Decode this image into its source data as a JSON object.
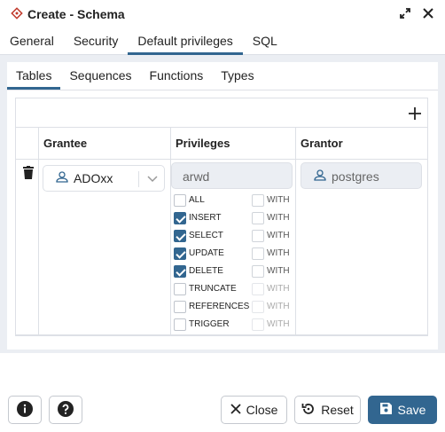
{
  "window": {
    "title": "Create - Schema"
  },
  "main_tabs": [
    "General",
    "Security",
    "Default privileges",
    "SQL"
  ],
  "sub_tabs": [
    "Tables",
    "Sequences",
    "Functions",
    "Types"
  ],
  "grid": {
    "columns": [
      "Grantee",
      "Privileges",
      "Grantor"
    ],
    "row": {
      "grantee": "ADOxx",
      "privileges_value": "arwd",
      "grantor": "postgres",
      "privileges": [
        {
          "label": "ALL",
          "checked": false,
          "with_label": "WITH"
        },
        {
          "label": "INSERT",
          "checked": true,
          "with_label": "WITH"
        },
        {
          "label": "SELECT",
          "checked": true,
          "with_label": "WITH"
        },
        {
          "label": "UPDATE",
          "checked": true,
          "with_label": "WITH"
        },
        {
          "label": "DELETE",
          "checked": true,
          "with_label": "WITH"
        },
        {
          "label": "TRUNCATE",
          "checked": false,
          "with_label": "WITH"
        },
        {
          "label": "REFERENCES",
          "checked": false,
          "with_label": "WITH"
        },
        {
          "label": "TRIGGER",
          "checked": false,
          "with_label": "WITH"
        }
      ]
    }
  },
  "footer": {
    "close": "Close",
    "reset": "Reset",
    "save": "Save"
  },
  "colors": {
    "accent": "#326690",
    "background": "#ebeef3",
    "border": "#dde0e6"
  },
  "icons": [
    "schema-icon",
    "expand-icon",
    "close-icon",
    "plus-icon",
    "trash-icon",
    "user-icon",
    "chevron-down-icon",
    "info-icon",
    "help-icon",
    "x-icon",
    "reset-icon",
    "save-icon"
  ]
}
